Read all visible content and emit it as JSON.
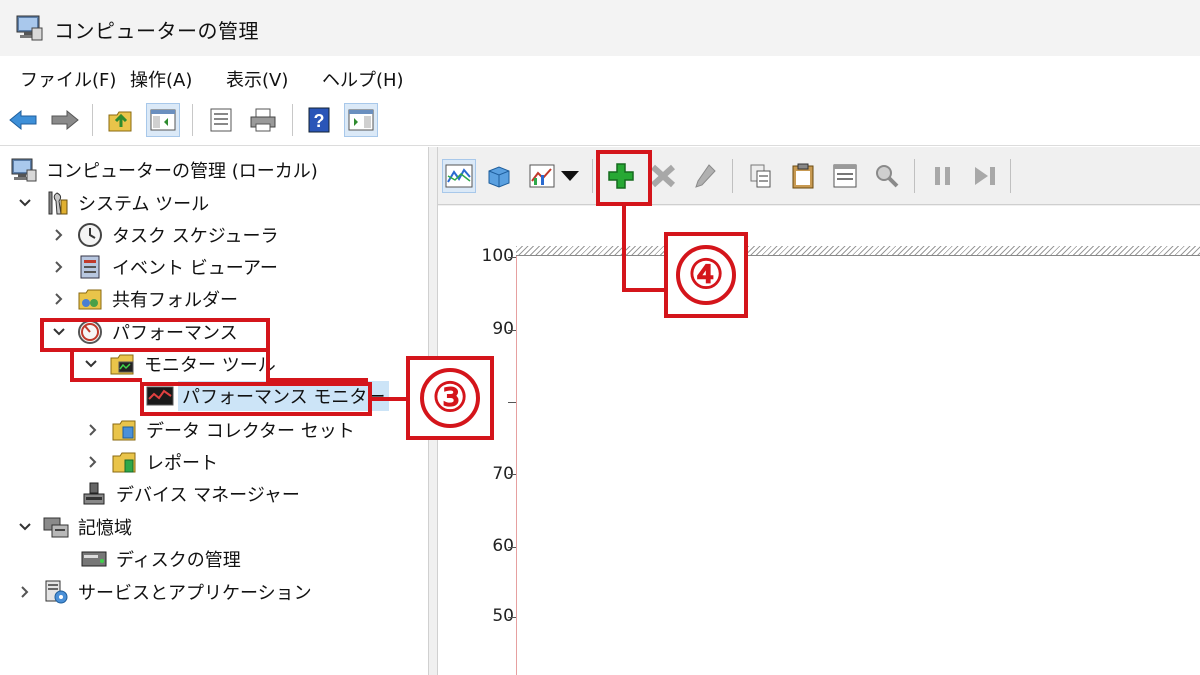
{
  "window": {
    "title": "コンピューターの管理"
  },
  "menu": {
    "items": [
      "ファイル(F)",
      "操作(A)",
      "表示(V)",
      "ヘルプ(H)"
    ]
  },
  "tree": {
    "root": "コンピューターの管理 (ローカル)",
    "system_tools": "システム ツール",
    "task_scheduler": "タスク スケジューラ",
    "event_viewer": "イベント ビューアー",
    "shared_folders": "共有フォルダー",
    "performance": "パフォーマンス",
    "monitor_tools": "モニター ツール",
    "performance_monitor": "パフォーマンス モニター",
    "data_collector_sets": "データ コレクター セット",
    "reports": "レポート",
    "device_manager": "デバイス マネージャー",
    "storage": "記憶域",
    "disk_management": "ディスクの管理",
    "services_apps": "サービスとアプリケーション"
  },
  "graph": {
    "y_ticks": [
      "100",
      "90",
      "",
      "70",
      "60",
      "50"
    ]
  },
  "annotations": {
    "step3": "③",
    "step4": "④"
  },
  "colors": {
    "callout": "#d4151b",
    "selected": "#cce4f7",
    "add_icon": "#27a834"
  }
}
